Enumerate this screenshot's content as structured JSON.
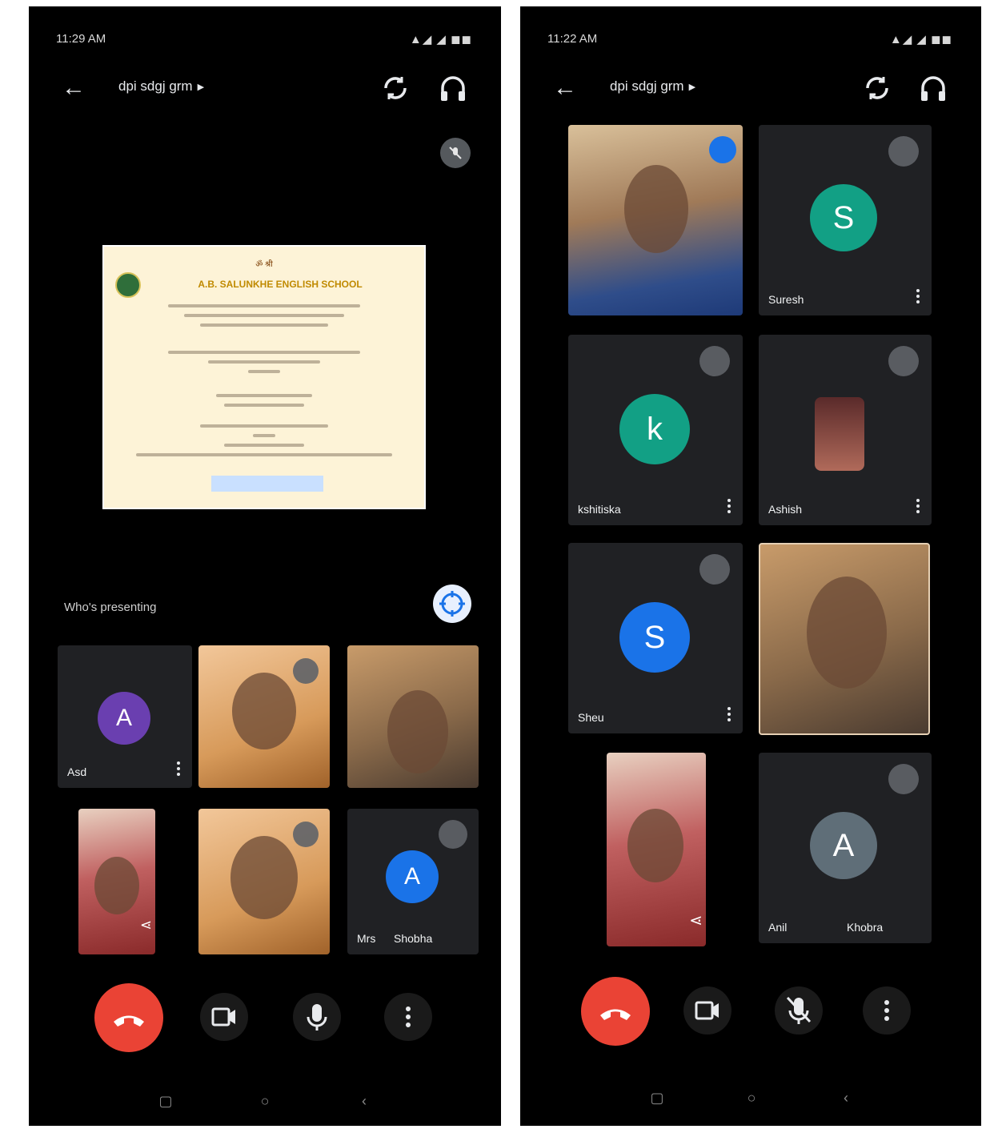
{
  "left": {
    "status": {
      "time": "11:29 AM",
      "icons": "▲◢ ◢ ◼◼"
    },
    "header": {
      "title": "dpi sdgj grm"
    },
    "tiles_section_label": "Who's presenting",
    "tiles": [
      {
        "name": "Asd",
        "kind": "avatar",
        "initial": "A",
        "color": "#6a3fb0"
      },
      {
        "name": "",
        "kind": "video"
      },
      {
        "name": "",
        "kind": "video"
      },
      {
        "name": "",
        "kind": "video"
      },
      {
        "name": "",
        "kind": "video"
      },
      {
        "name": "Mrs",
        "name2": "Shobha",
        "kind": "avatar",
        "initial": "A",
        "color": "#1a73e8"
      }
    ],
    "presentation": {
      "heading": "ॐ श्री",
      "org_name": "A.B. SALUNKHE ENGLISH SCHOOL"
    }
  },
  "right": {
    "status": {
      "time": "11:22 AM",
      "icons": "▲◢ ◢ ◼◼"
    },
    "header": {
      "title": "dpi sdgj grm"
    },
    "tiles": [
      {
        "name": "",
        "kind": "video"
      },
      {
        "name": "Suresh",
        "kind": "avatar",
        "initial": "S",
        "color": "#12a085"
      },
      {
        "name": "kshitiska",
        "kind": "avatar",
        "initial": "k",
        "color": "#12a085"
      },
      {
        "name": "Ashish",
        "kind": "video"
      },
      {
        "name": "Sheu",
        "kind": "avatar",
        "initial": "S",
        "color": "#1a73e8"
      },
      {
        "name": "",
        "kind": "video"
      },
      {
        "name": "",
        "kind": "video"
      },
      {
        "name": "Anil",
        "name2": "Khobra",
        "kind": "avatar",
        "initial": "A",
        "color": "#5f6e78"
      }
    ]
  },
  "colors": {
    "end_call": "#ea4335",
    "background": "#000000"
  }
}
